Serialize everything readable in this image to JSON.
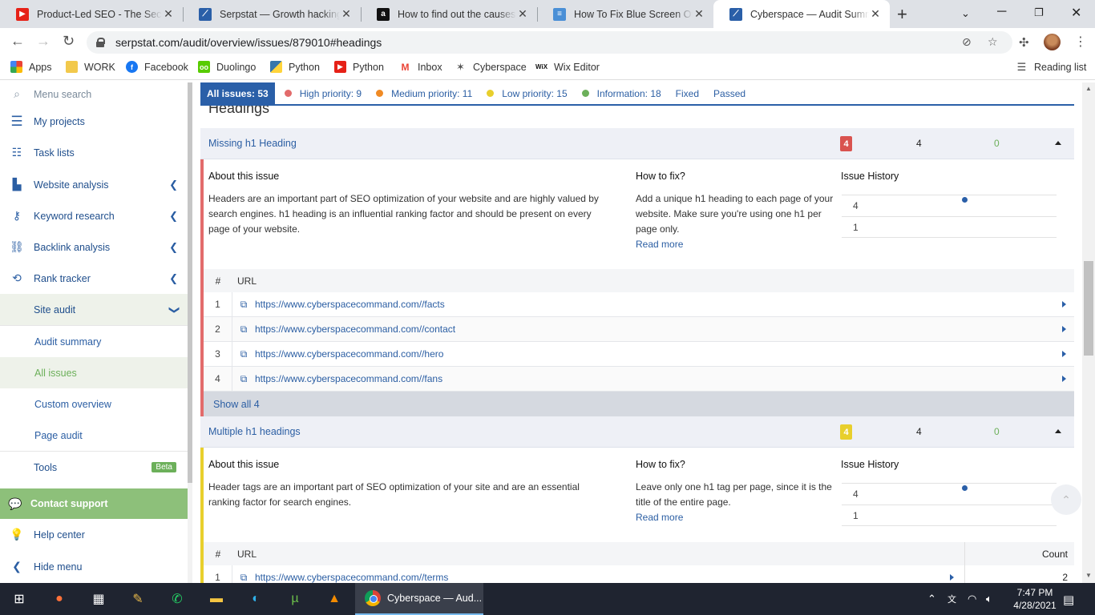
{
  "browser": {
    "tabs": [
      {
        "title": "Product-Led SEO - The Secret",
        "icon": "youtube-icon"
      },
      {
        "title": "Serpstat — Growth hacking to",
        "icon": "serpstat-icon"
      },
      {
        "title": "How to find out the causes of",
        "icon": "amazon-icon"
      },
      {
        "title": "How To Fix Blue Screen Of De",
        "icon": "doc-icon"
      },
      {
        "title": "Cyberspace — Audit Summa",
        "icon": "serpstat-icon"
      }
    ],
    "url": "serpstat.com/audit/overview/issues/879010#headings",
    "bookmarks": [
      "Apps",
      "WORK",
      "Facebook",
      "Duolingo",
      "Python",
      "Python",
      "Inbox",
      "Cyberspace",
      "Wix Editor"
    ],
    "reading_list": "Reading list"
  },
  "sidebar": {
    "search_placeholder": "Menu search",
    "items": [
      {
        "label": "My projects"
      },
      {
        "label": "Task lists"
      },
      {
        "label": "Website analysis"
      },
      {
        "label": "Keyword research"
      },
      {
        "label": "Backlink analysis"
      },
      {
        "label": "Rank tracker"
      },
      {
        "label": "Site audit"
      }
    ],
    "subitems": [
      "Audit summary",
      "All issues",
      "Custom overview",
      "Page audit"
    ],
    "tools": "Tools",
    "beta": "Beta",
    "contact": "Contact support",
    "help": "Help center",
    "hide": "Hide menu"
  },
  "filters": {
    "all": "All issues: 53",
    "high": "High priority: 9",
    "medium": "Medium priority: 11",
    "low": "Low priority: 15",
    "info": "Information: 18",
    "fixed": "Fixed",
    "passed": "Passed",
    "colors": {
      "high": "#e26b6b",
      "medium": "#f08a24",
      "low": "#e8cf2c",
      "info": "#6cb05a"
    }
  },
  "section_title": "Headings",
  "issues": [
    {
      "name": "Missing h1 Heading",
      "badge": "4",
      "badge_color": "#d9534f",
      "count": "4",
      "new": "0",
      "about_title": "About this issue",
      "about": "Headers are an important part of SEO optimization of your website and are highly valued by search engines. h1 heading is an influential ranking factor and should be present on every page of your website.",
      "fix_title": "How to fix?",
      "fix": "Add a unique h1 heading to each page of your website. Make sure you're using one h1 per page only.",
      "read_more": "Read more",
      "history_title": "Issue History",
      "history": [
        "4",
        "1"
      ],
      "url_hdr_num": "#",
      "url_hdr": "URL",
      "urls": [
        {
          "n": "1",
          "u": "https://www.cyberspacecommand.com//facts"
        },
        {
          "n": "2",
          "u": "https://www.cyberspacecommand.com//contact"
        },
        {
          "n": "3",
          "u": "https://www.cyberspacecommand.com//hero"
        },
        {
          "n": "4",
          "u": "https://www.cyberspacecommand.com//fans"
        }
      ],
      "show_all": "Show all 4"
    },
    {
      "name": "Multiple h1 headings",
      "badge": "4",
      "badge_color": "#e8cf2c",
      "count": "4",
      "new": "0",
      "about_title": "About this issue",
      "about": "Header tags are an important part of SEO optimization of your site and are an essential ranking factor for search engines.",
      "fix_title": "How to fix?",
      "fix": "Leave only one h1 tag per page, since it is the title of the entire page.",
      "read_more": "Read more",
      "history_title": "Issue History",
      "history": [
        "4",
        "1"
      ],
      "url_hdr_num": "#",
      "url_hdr": "URL",
      "url_hdr_count": "Count",
      "urls": [
        {
          "n": "1",
          "u": "https://www.cyberspacecommand.com//terms",
          "count": "2"
        }
      ]
    }
  ],
  "taskbar": {
    "active_title": "Cyberspace — Aud...",
    "time": "7:47 PM",
    "date": "4/28/2021"
  }
}
